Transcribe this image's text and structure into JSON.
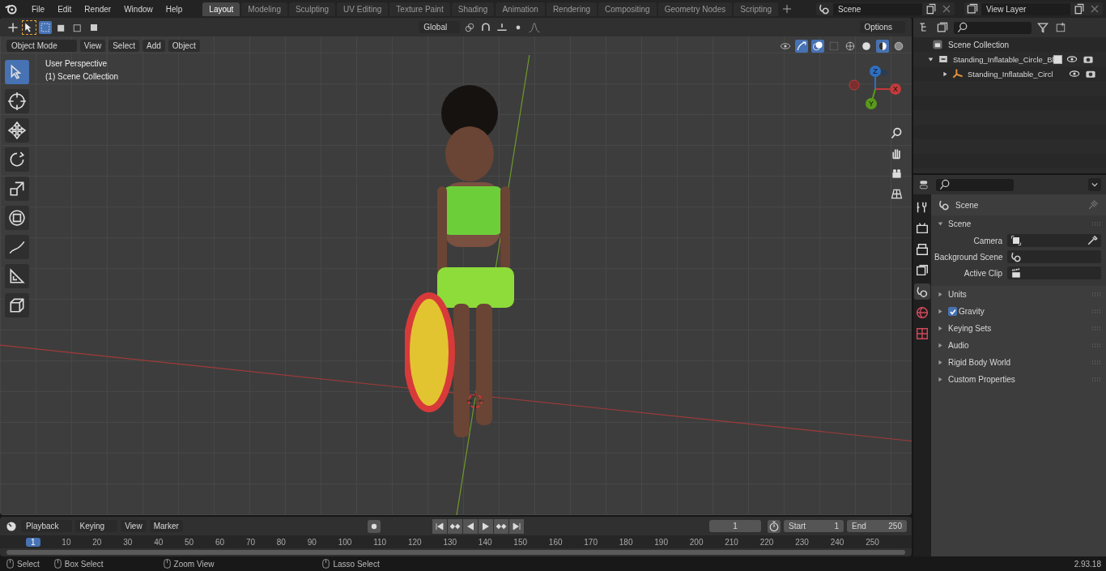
{
  "menu": [
    "File",
    "Edit",
    "Render",
    "Window",
    "Help"
  ],
  "workspaces": [
    {
      "label": "Layout",
      "selected": true
    },
    {
      "label": "Modeling",
      "selected": false
    },
    {
      "label": "Sculpting",
      "selected": false
    },
    {
      "label": "UV Editing",
      "selected": false
    },
    {
      "label": "Texture Paint",
      "selected": false
    },
    {
      "label": "Shading",
      "selected": false
    },
    {
      "label": "Animation",
      "selected": false
    },
    {
      "label": "Rendering",
      "selected": false
    },
    {
      "label": "Compositing",
      "selected": false
    },
    {
      "label": "Geometry Nodes",
      "selected": false
    },
    {
      "label": "Scripting",
      "selected": false
    }
  ],
  "scene": "Scene",
  "view_layer": "View Layer",
  "viewport": {
    "transform_orientation": "Global",
    "options": "Options",
    "mode": "Object Mode",
    "menus": [
      "View",
      "Select",
      "Add",
      "Object"
    ],
    "overlay_text": [
      "User Perspective",
      "(1) Scene Collection"
    ],
    "gizmo_axes": [
      "Z",
      "Y",
      "X"
    ],
    "tools": [
      {
        "kind": "select",
        "selected": true
      },
      {
        "kind": "cursor",
        "selected": false
      },
      {
        "kind": "move",
        "selected": false
      },
      {
        "kind": "rotate",
        "selected": false
      },
      {
        "kind": "scale",
        "selected": false
      },
      {
        "kind": "transform",
        "selected": false
      },
      {
        "kind": "annotate",
        "selected": false
      },
      {
        "kind": "measure",
        "selected": false
      },
      {
        "kind": "add",
        "selected": false
      }
    ]
  },
  "outliner": {
    "root": "Scene Collection",
    "items": [
      {
        "label": "Standing_Inflatable_Circle_Bl",
        "checked": true,
        "expanded": true,
        "children": [
          {
            "label": "Standing_Inflatable_Circl",
            "expanded": false
          }
        ]
      }
    ]
  },
  "properties": {
    "tabs": [
      {
        "kind": "tool",
        "selected": false
      },
      {
        "kind": "render",
        "selected": false
      },
      {
        "kind": "output",
        "selected": false
      },
      {
        "kind": "view_layer",
        "selected": false
      },
      {
        "kind": "scene",
        "selected": true
      },
      {
        "kind": "world",
        "selected": false
      },
      {
        "kind": "texture",
        "selected": false
      }
    ],
    "context": "Scene",
    "panels": [
      {
        "title": "Scene",
        "expanded": true,
        "fields": [
          {
            "label": "Camera",
            "kind": "camera"
          },
          {
            "label": "Background Scene",
            "kind": "scene"
          },
          {
            "label": "Active Clip",
            "kind": "clip"
          }
        ]
      },
      {
        "title": "Units",
        "expanded": false
      },
      {
        "title": "Gravity",
        "expanded": false,
        "checked": true
      },
      {
        "title": "Keying Sets",
        "expanded": false
      },
      {
        "title": "Audio",
        "expanded": false
      },
      {
        "title": "Rigid Body World",
        "expanded": false
      },
      {
        "title": "Custom Properties",
        "expanded": false
      }
    ]
  },
  "timeline": {
    "menus": [
      "Playback",
      "Keying",
      "View",
      "Marker"
    ],
    "current_frame": "1",
    "start_label": "Start",
    "start": "1",
    "end_label": "End",
    "end": "250",
    "ruler_current": "1",
    "ruler_ticks": [
      "10",
      "20",
      "30",
      "40",
      "50",
      "60",
      "70",
      "80",
      "90",
      "100",
      "110",
      "120",
      "130",
      "140",
      "150",
      "160",
      "170",
      "180",
      "190",
      "200",
      "210",
      "220",
      "230",
      "240",
      "250"
    ]
  },
  "status_bar": {
    "hints": [
      "Select",
      "Box Select",
      "Zoom View",
      "Lasso Select"
    ],
    "version": "2.93.18"
  }
}
